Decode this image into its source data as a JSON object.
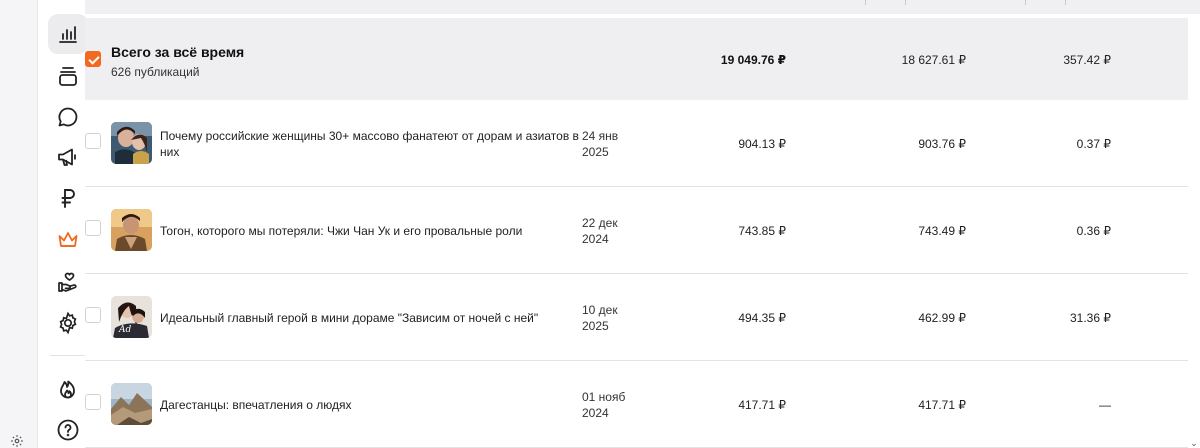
{
  "colors": {
    "accent": "#f26a22",
    "active_nav_bg": "#ececef",
    "total_row_bg": "#efeff1"
  },
  "sidebar": {
    "items": [
      {
        "icon": "chart-bars-icon",
        "active": true
      },
      {
        "icon": "stack-icon"
      },
      {
        "icon": "chat-bubble-icon"
      },
      {
        "icon": "megaphone-icon"
      },
      {
        "icon": "ruble-icon"
      },
      {
        "icon": "crown-icon"
      },
      {
        "icon": "hand-heart-icon"
      },
      {
        "icon": "gear-icon"
      },
      {
        "icon": "fire-icon"
      },
      {
        "icon": "help-icon"
      }
    ]
  },
  "total": {
    "checked": true,
    "title": "Всего за всё время",
    "subtitle": "626 публикаций",
    "col1": "19 049.76 ₽",
    "col2": "18 627.61 ₽",
    "col3": "357.42 ₽"
  },
  "rows": [
    {
      "title": "Почему российские женщины 30+ массово фанатеют от дорам и азиатов в них",
      "date": "24 янв 2025",
      "col1": "904.13 ₽",
      "col2": "903.76 ₽",
      "col3": "0.37 ₽"
    },
    {
      "title": "Тогон, которого мы потеряли: Чжи Чан Ук и его провальные роли",
      "date": "22 дек 2024",
      "col1": "743.85 ₽",
      "col2": "743.49 ₽",
      "col3": "0.36 ₽"
    },
    {
      "title": "Идеальный главный герой в мини дораме \"Зависим от ночей с ней\"",
      "date": "10 дек 2025",
      "col1": "494.35 ₽",
      "col2": "462.99 ₽",
      "col3": "31.36 ₽"
    },
    {
      "title": "Дагестанцы: впечатления о людях",
      "date": "01 нояб 2024",
      "col1": "417.71 ₽",
      "col2": "417.71 ₽",
      "col3": "—"
    }
  ]
}
